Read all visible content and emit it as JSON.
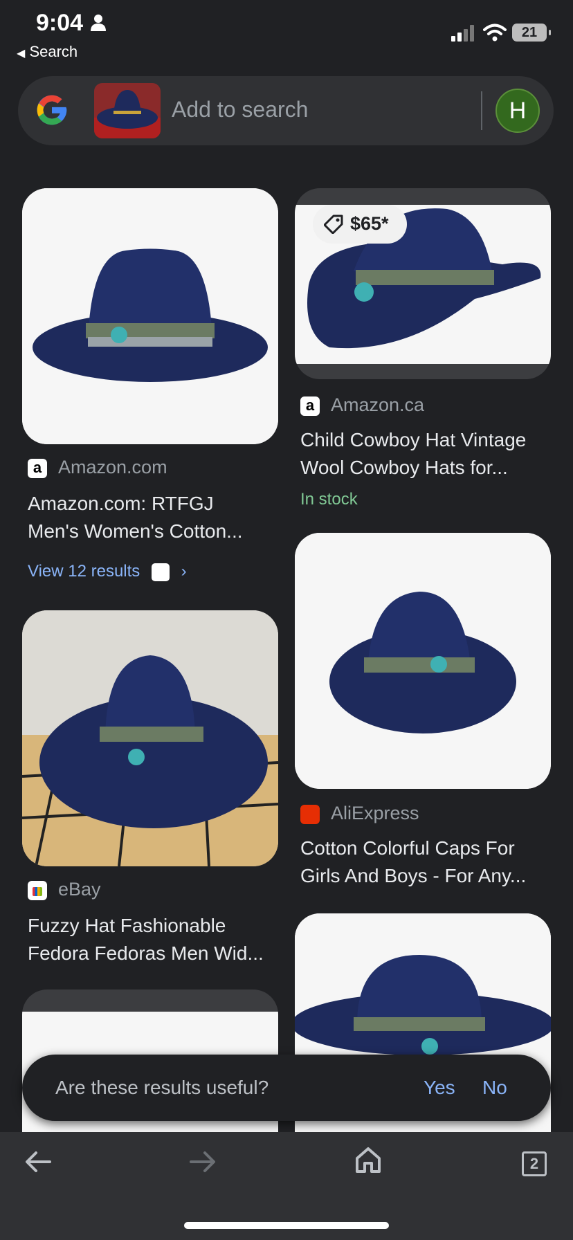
{
  "status_bar": {
    "time": "9:04",
    "battery": "21",
    "back_label": "Search"
  },
  "search": {
    "placeholder": "Add to search",
    "avatar_letter": "H"
  },
  "results": [
    {
      "source": "Amazon.com",
      "title_line1": "Amazon.com: RTFGJ",
      "title_line2": "Men's Women's Cotton...",
      "view_results": "View 12 results"
    },
    {
      "source": "Amazon.ca",
      "price": "$65*",
      "title_line1": "Child Cowboy Hat Vintage",
      "title_line2": "Wool Cowboy Hats for...",
      "stock": "In stock"
    },
    {
      "source": "eBay",
      "title_line1": "Fuzzy Hat Fashionable",
      "title_line2": "Fedora Fedoras Men Wid..."
    },
    {
      "source": "AliExpress",
      "title_line1": "Cotton Colorful Caps For",
      "title_line2": "Girls And Boys - For Any..."
    }
  ],
  "feedback": {
    "question": "Are these results useful?",
    "yes": "Yes",
    "no": "No"
  },
  "toolbar": {
    "tab_count": "2"
  },
  "colors": {
    "hat": "#1e2a5c",
    "link": "#8ab4f8",
    "stock": "#81c995"
  }
}
